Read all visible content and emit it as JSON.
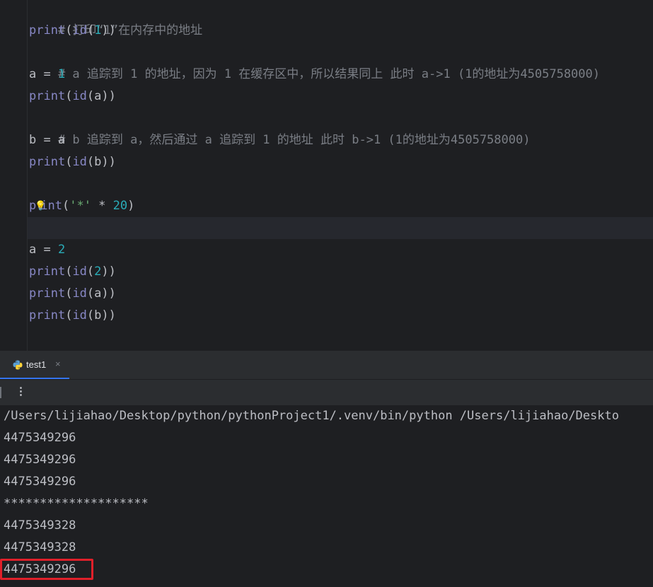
{
  "editor": {
    "comment1": "# 打印“1”在内存中的地址",
    "comment2": "# a 追踪到 1 的地址，因为 1 在缓存区中，所以结果同上 此时 a->1 (1的地址为4505758000)",
    "comment3": "# b 追踪到 a，然后通过 a 追踪到 1 的地址 此时 b->1 (1的地址为4505758000)",
    "t_print": "print",
    "t_id": "id",
    "t_open": "(",
    "t_close": ")",
    "t_close2": "))",
    "t_one": "1",
    "t_two": "2",
    "t_a": "a",
    "t_b": "b",
    "t_assign_a": "a = ",
    "t_assign_b": "b = a",
    "t_p": "p",
    "t_int": "int",
    "t_star_str": "'*'",
    "t_times": " * ",
    "t_twenty": "20"
  },
  "run_panel": {
    "tab_label": "test1",
    "tab_close": "×",
    "more_label": "⋮"
  },
  "console": {
    "lines": [
      "/Users/lijiahao/Desktop/python/pythonProject1/.venv/bin/python /Users/lijiahao/Deskto",
      "4475349296",
      "4475349296",
      "4475349296",
      "********************",
      "4475349328",
      "4475349328",
      "4475349296"
    ],
    "highlight_color": "#e0202a"
  }
}
